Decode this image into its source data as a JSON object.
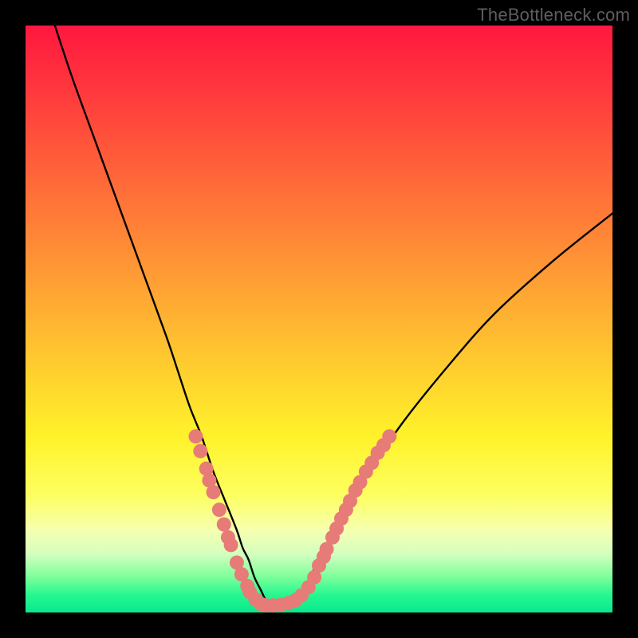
{
  "watermark": "TheBottleneck.com",
  "palette": {
    "black": "#000000",
    "curve": "#000000",
    "dots": "#e77b78",
    "gradient_stops": [
      "#ff173f",
      "#ff5a3a",
      "#ffc330",
      "#fdff60",
      "#26f791"
    ]
  },
  "chart_data": {
    "type": "line",
    "title": "",
    "xlabel": "",
    "ylabel": "",
    "xlim": [
      0,
      100
    ],
    "ylim": [
      0,
      100
    ],
    "grid": false,
    "annotations": [
      "TheBottleneck.com"
    ],
    "series": [
      {
        "name": "v-curve",
        "x": [
          5,
          8,
          12,
          16,
          20,
          24,
          26,
          28,
          30,
          32,
          34,
          36,
          37,
          38,
          39,
          40,
          41,
          42,
          43,
          44,
          46,
          48,
          50,
          54,
          58,
          64,
          72,
          80,
          90,
          100
        ],
        "y": [
          100,
          91,
          80,
          69,
          58,
          47,
          41,
          35,
          30,
          24,
          19,
          14,
          11,
          9,
          6,
          4,
          2,
          1,
          1,
          1,
          2,
          5,
          9,
          16,
          23,
          32,
          42,
          51,
          60,
          68
        ]
      }
    ],
    "highlight_dots": {
      "name": "pink-marks",
      "points": [
        {
          "x": 29.0,
          "y": 30.0
        },
        {
          "x": 29.8,
          "y": 27.5
        },
        {
          "x": 30.8,
          "y": 24.5
        },
        {
          "x": 31.3,
          "y": 22.5
        },
        {
          "x": 32.0,
          "y": 20.5
        },
        {
          "x": 33.0,
          "y": 17.5
        },
        {
          "x": 33.8,
          "y": 15.0
        },
        {
          "x": 34.5,
          "y": 12.8
        },
        {
          "x": 35.0,
          "y": 11.5
        },
        {
          "x": 36.0,
          "y": 8.5
        },
        {
          "x": 36.8,
          "y": 6.5
        },
        {
          "x": 37.8,
          "y": 4.5
        },
        {
          "x": 38.2,
          "y": 3.5
        },
        {
          "x": 39.2,
          "y": 2.2
        },
        {
          "x": 40.0,
          "y": 1.5
        },
        {
          "x": 41.0,
          "y": 1.2
        },
        {
          "x": 42.2,
          "y": 1.2
        },
        {
          "x": 43.5,
          "y": 1.3
        },
        {
          "x": 44.8,
          "y": 1.6
        },
        {
          "x": 46.0,
          "y": 2.1
        },
        {
          "x": 47.0,
          "y": 2.9
        },
        {
          "x": 48.2,
          "y": 4.3
        },
        {
          "x": 49.2,
          "y": 6.0
        },
        {
          "x": 50.0,
          "y": 8.0
        },
        {
          "x": 50.8,
          "y": 9.5
        },
        {
          "x": 51.3,
          "y": 10.8
        },
        {
          "x": 52.3,
          "y": 12.8
        },
        {
          "x": 53.0,
          "y": 14.3
        },
        {
          "x": 53.8,
          "y": 16.0
        },
        {
          "x": 54.6,
          "y": 17.5
        },
        {
          "x": 55.3,
          "y": 19.0
        },
        {
          "x": 56.2,
          "y": 20.8
        },
        {
          "x": 57.0,
          "y": 22.2
        },
        {
          "x": 58.0,
          "y": 24.0
        },
        {
          "x": 59.0,
          "y": 25.5
        },
        {
          "x": 60.0,
          "y": 27.2
        },
        {
          "x": 61.0,
          "y": 28.5
        },
        {
          "x": 62.0,
          "y": 30.0
        }
      ]
    }
  }
}
